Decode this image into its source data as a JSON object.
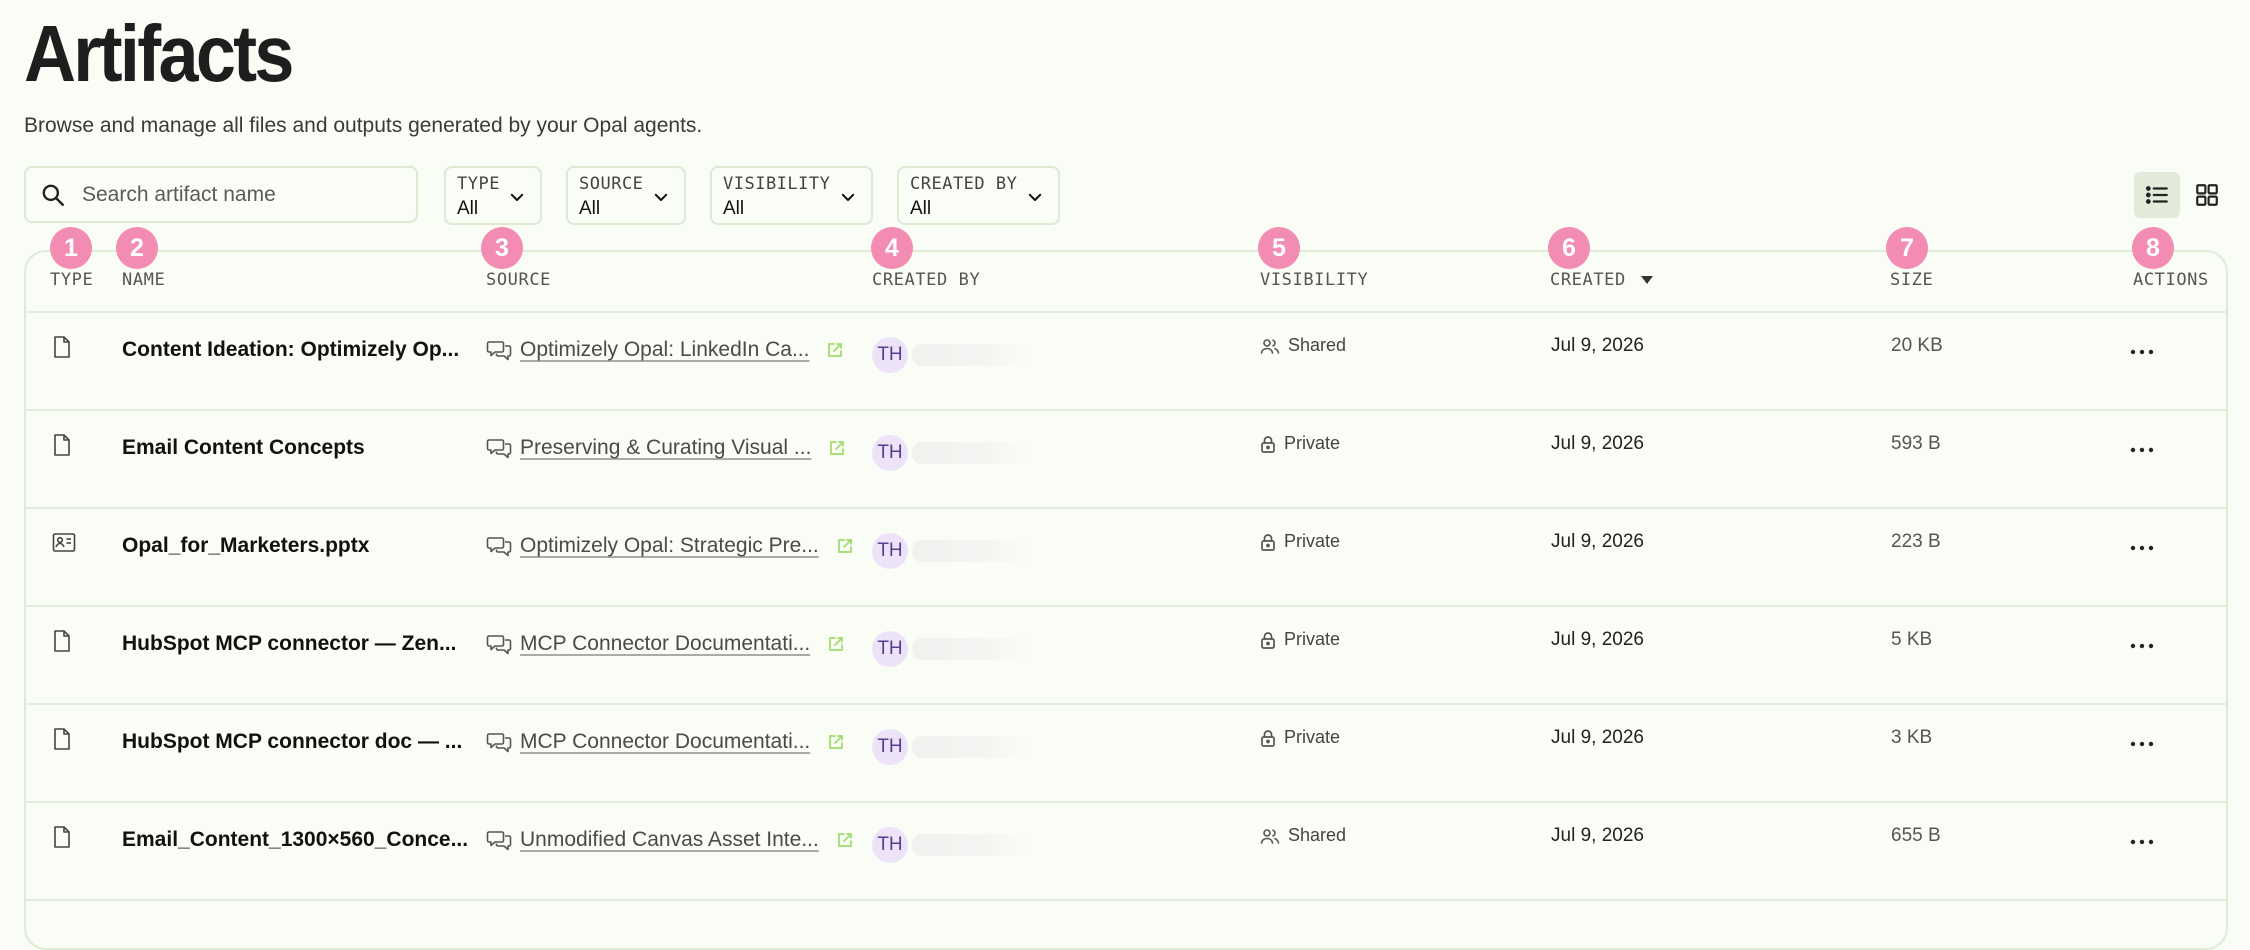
{
  "page": {
    "title": "Artifacts",
    "subtitle": "Browse and manage all files and outputs generated by your Opal agents."
  },
  "search": {
    "placeholder": "Search artifact name"
  },
  "filters": [
    {
      "label": "TYPE",
      "value": "All"
    },
    {
      "label": "SOURCE",
      "value": "All"
    },
    {
      "label": "VISIBILITY",
      "value": "All"
    },
    {
      "label": "CREATED BY",
      "value": "All"
    }
  ],
  "view_toggle": {
    "active": "list",
    "icons": [
      "list-icon",
      "grid-icon"
    ]
  },
  "table": {
    "columns": [
      {
        "label": "TYPE",
        "badge": "1"
      },
      {
        "label": "NAME",
        "badge": "2"
      },
      {
        "label": "SOURCE",
        "badge": "3"
      },
      {
        "label": "CREATED BY",
        "badge": "4"
      },
      {
        "label": "VISIBILITY",
        "badge": "5"
      },
      {
        "label": "CREATED",
        "badge": "6",
        "sorted": "descending"
      },
      {
        "label": "SIZE",
        "badge": "7"
      },
      {
        "label": "ACTIONS",
        "badge": "8"
      }
    ],
    "rows": [
      {
        "type_icon": "file-icon",
        "name": "Content Ideation: Optimizely Op...",
        "source": "Optimizely Opal: LinkedIn Ca...",
        "creator_initials": "TH",
        "visibility": "Shared",
        "created": "Jul 9, 2026",
        "size": "20 KB"
      },
      {
        "type_icon": "file-icon",
        "name": "Email Content Concepts",
        "source": "Preserving & Curating Visual ...",
        "creator_initials": "TH",
        "visibility": "Private",
        "created": "Jul 9, 2026",
        "size": "593 B"
      },
      {
        "type_icon": "presentation-icon",
        "name": "Opal_for_Marketers.pptx",
        "source": "Optimizely Opal: Strategic Pre...",
        "creator_initials": "TH",
        "visibility": "Private",
        "created": "Jul 9, 2026",
        "size": "223 B"
      },
      {
        "type_icon": "file-icon",
        "name": "HubSpot MCP connector — Zen...",
        "source": "MCP Connector Documentati...",
        "creator_initials": "TH",
        "visibility": "Private",
        "created": "Jul 9, 2026",
        "size": "5 KB"
      },
      {
        "type_icon": "file-icon",
        "name": "HubSpot MCP connector doc — ...",
        "source": "MCP Connector Documentati...",
        "creator_initials": "TH",
        "visibility": "Private",
        "created": "Jul 9, 2026",
        "size": "3 KB"
      },
      {
        "type_icon": "file-icon",
        "name": "Email_Content_1300×560_Conce...",
        "source": "Unmodified Canvas Asset Inte...",
        "creator_initials": "TH",
        "visibility": "Shared",
        "created": "Jul 9, 2026",
        "size": "655 B"
      }
    ]
  },
  "colors": {
    "background": "#fafcf6",
    "border": "#dfe9d2",
    "badge": "#f38cb2",
    "avatar_bg": "#ece3f9",
    "external_link": "#9fdc6a"
  }
}
